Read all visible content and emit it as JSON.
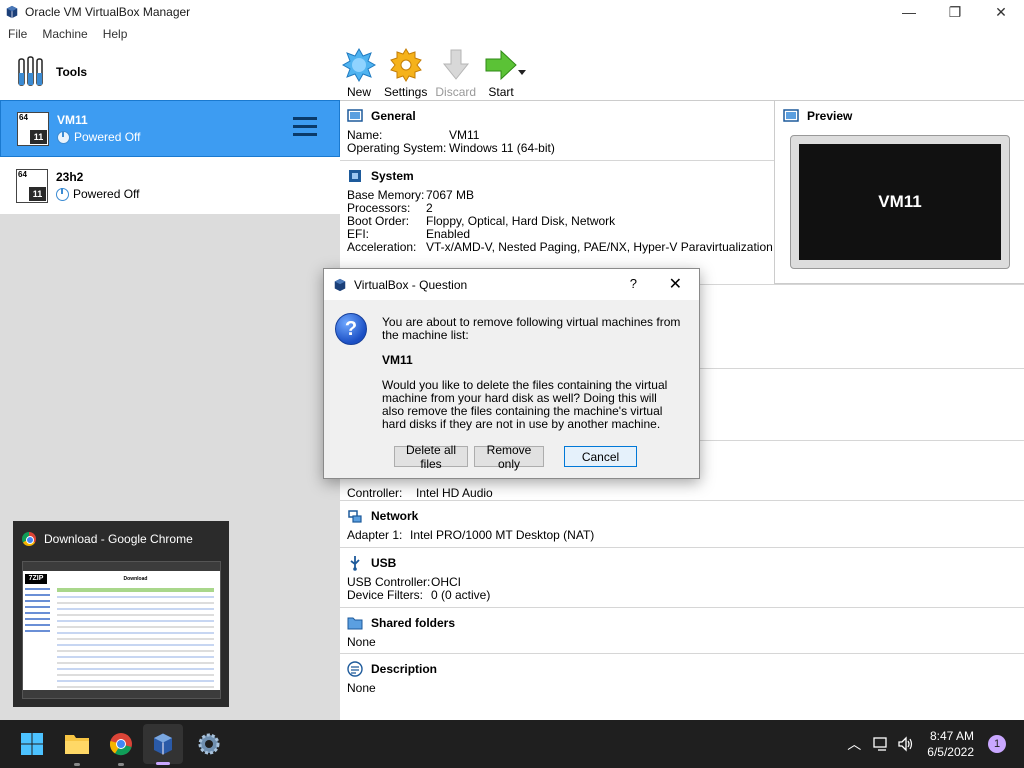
{
  "window": {
    "title": "Oracle VM VirtualBox Manager",
    "minimize_glyph": "—",
    "restore_glyph": "❐",
    "close_glyph": "✕"
  },
  "menu": [
    "File",
    "Machine",
    "Help"
  ],
  "tools_label": "Tools",
  "vms": [
    {
      "name": "VM11",
      "state": "Powered Off",
      "arch": "64",
      "os": "11"
    },
    {
      "name": "23h2",
      "state": "Powered Off",
      "arch": "64",
      "os": "11"
    }
  ],
  "toolbar": {
    "new_label": "New",
    "settings_label": "Settings",
    "discard_label": "Discard",
    "start_label": "Start"
  },
  "general": {
    "title": "General",
    "name_key": "Name:",
    "name_val": "VM11",
    "os_key": "Operating System:",
    "os_val": "Windows 11 (64-bit)"
  },
  "system": {
    "title": "System",
    "rows": [
      {
        "k": "Base Memory:",
        "v": "7067 MB"
      },
      {
        "k": "Processors:",
        "v": "2"
      },
      {
        "k": "Boot Order:",
        "v": "Floppy, Optical, Hard Disk, Network"
      },
      {
        "k": "EFI:",
        "v": "Enabled"
      },
      {
        "k": "Acceleration:",
        "v": "VT-x/AMD-V, Nested Paging, PAE/NX, Hyper-V Paravirtualization"
      }
    ]
  },
  "preview": {
    "title": "Preview",
    "screen_text": "VM11"
  },
  "audio": {
    "controller_key": "Controller:",
    "controller_val": "Intel HD Audio"
  },
  "network": {
    "title": "Network",
    "adapter_key": "Adapter 1:",
    "adapter_val": "Intel PRO/1000 MT Desktop (NAT)"
  },
  "usb": {
    "title": "USB",
    "controller_key": "USB Controller:",
    "controller_val": "OHCI",
    "filters_key": "Device Filters:",
    "filters_val": "0 (0 active)"
  },
  "shared": {
    "title": "Shared folders",
    "value": "None"
  },
  "description": {
    "title": "Description",
    "value": "None"
  },
  "dialog": {
    "title": "VirtualBox - Question",
    "help": "?",
    "close": "✕",
    "line1": "You are about to remove following virtual machines from the machine list:",
    "vm_name": "VM11",
    "line2": "Would you like to delete the files containing the virtual machine from your hard disk as well? Doing this will also remove the files containing the machine's virtual hard disks if they are not in use by another machine.",
    "btn_delete": "Delete all files",
    "btn_remove": "Remove only",
    "btn_cancel": "Cancel"
  },
  "chrome_preview": {
    "title": "Download - Google Chrome",
    "page_heading": "Download"
  },
  "taskbar": {
    "time": "8:47 AM",
    "date": "6/5/2022",
    "notifications": "1"
  },
  "colors": {
    "selection": "#3d9cf2",
    "taskbar": "#1f1f1f",
    "accent": "#0078d7"
  }
}
